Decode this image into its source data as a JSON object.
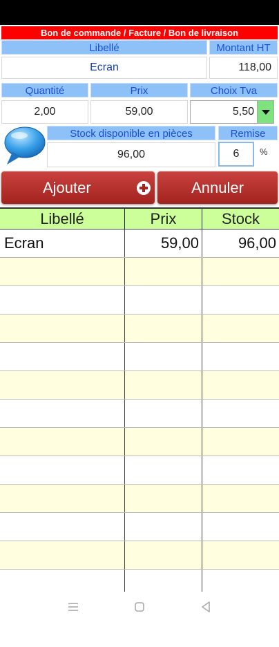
{
  "banner": "Bon de commande / Facture / Bon de livraison",
  "labels": {
    "libelle": "Libellé",
    "montant_ht": "Montant HT",
    "quantite": "Quantité",
    "prix": "Prix",
    "choix_tva": "Choix Tva",
    "stock": "Stock disponible en pièces",
    "remise": "Remise"
  },
  "fields": {
    "libelle": "Ecran",
    "montant_ht": "118,00",
    "quantite": "2,00",
    "prix": "59,00",
    "tva": "5,50",
    "stock": "96,00",
    "remise": "6",
    "percent": "%"
  },
  "buttons": {
    "add": "Ajouter",
    "cancel": "Annuler"
  },
  "table": {
    "headers": [
      "Libellé",
      "Prix",
      "Stock"
    ],
    "rows": [
      [
        "Ecran",
        "59,00",
        "96,00"
      ]
    ]
  },
  "colors": {
    "banner": "#ff0000",
    "header_bg": "#8ec1f7",
    "header_text": "#1a4fd6",
    "table_header_bg": "#ccff99",
    "alt_row_bg": "#ffffe0",
    "button": "#a2231f"
  }
}
